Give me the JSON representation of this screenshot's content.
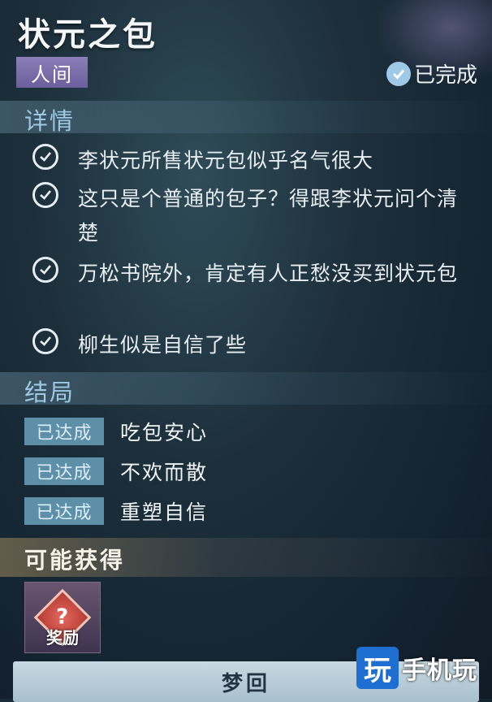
{
  "header": {
    "title": "状元之包",
    "tag": "人间",
    "status": "已完成"
  },
  "details": {
    "section_title": "详情",
    "items": [
      {
        "text": "李状元所售状元包似乎名气很大"
      },
      {
        "text": "这只是个普通的包子？得跟李状元问个清楚"
      },
      {
        "text": "万松书院外，肯定有人正愁没买到状元包"
      },
      {
        "text": "柳生似是自信了些"
      }
    ]
  },
  "endings": {
    "section_title": "结局",
    "items": [
      {
        "badge": "已达成",
        "text": "吃包安心"
      },
      {
        "badge": "已达成",
        "text": "不欢而散"
      },
      {
        "badge": "已达成",
        "text": "重塑自信"
      }
    ]
  },
  "rewards": {
    "section_title": "可能获得",
    "item_label": "奖励"
  },
  "action": {
    "button_label": "梦回"
  },
  "watermark": {
    "logo": "玩",
    "text": "手机玩"
  }
}
